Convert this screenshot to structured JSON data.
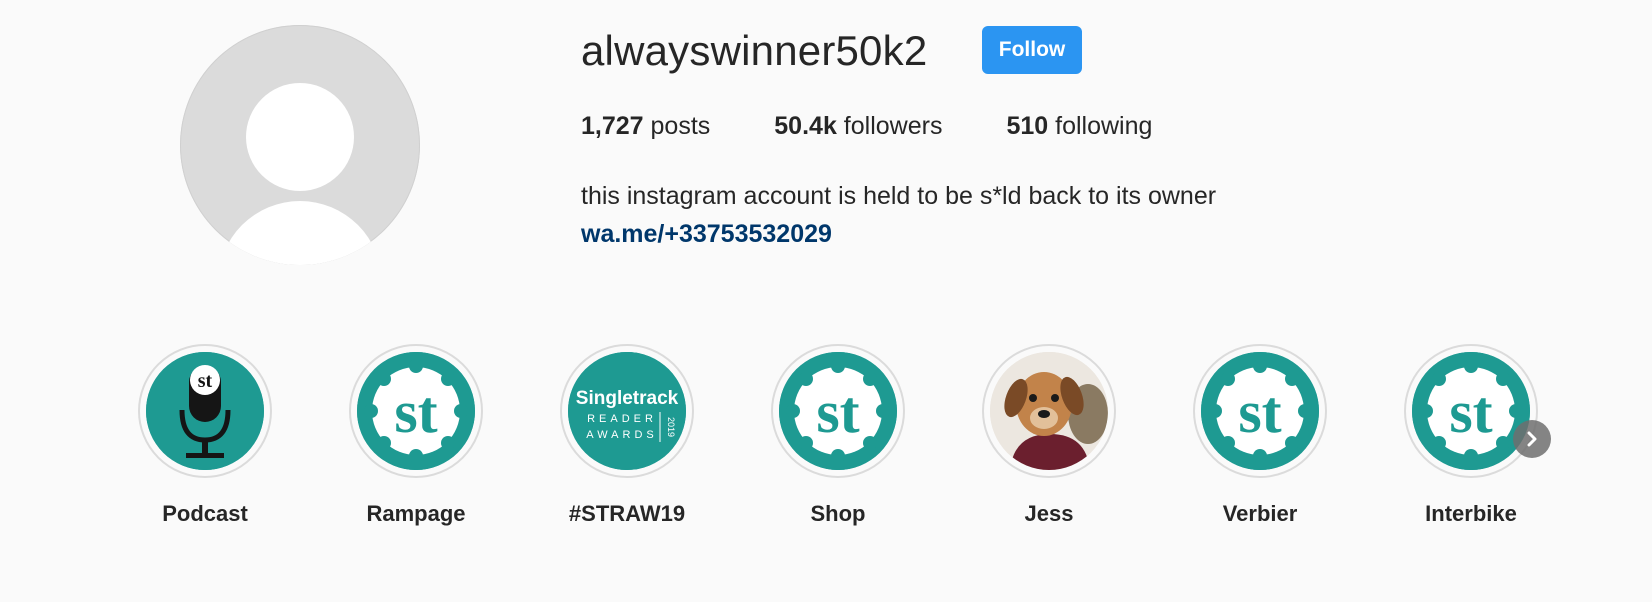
{
  "profile": {
    "username": "alwayswinner50k2",
    "follow_label": "Follow",
    "stats": {
      "posts_count": "1,727",
      "posts_label": "posts",
      "followers_count": "50.4k",
      "followers_label": "followers",
      "following_count": "510",
      "following_label": "following"
    },
    "bio": "this instagram account is held to be s*ld back to its owner",
    "link": "wa.me/+33753532029"
  },
  "highlights": [
    {
      "label": "Podcast",
      "icon": "microphone-icon"
    },
    {
      "label": "Rampage",
      "icon": "st-logo-icon"
    },
    {
      "label": "#STRAW19",
      "icon": "singletrack-awards-icon",
      "image_text": [
        "Singletrack",
        "READER",
        "AWARDS",
        "2019"
      ]
    },
    {
      "label": "Shop",
      "icon": "st-logo-icon"
    },
    {
      "label": "Jess",
      "icon": "dog-photo-icon"
    },
    {
      "label": "Verbier",
      "icon": "st-logo-icon"
    },
    {
      "label": "Interbike",
      "icon": "st-logo-icon"
    }
  ],
  "colors": {
    "follow_button": "#2b95f2",
    "link": "#00376b",
    "highlight_teal": "#1e9a92"
  }
}
